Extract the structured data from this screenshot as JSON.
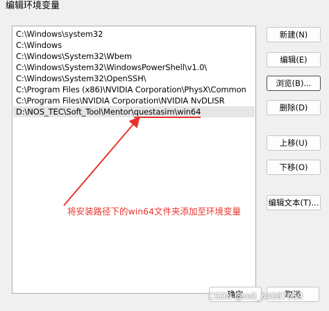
{
  "window": {
    "title": "编辑环境变量"
  },
  "list": {
    "items": [
      {
        "text": "C:\\Windows\\system32"
      },
      {
        "text": "C:\\Windows"
      },
      {
        "text": "C:\\Windows\\System32\\Wbem"
      },
      {
        "text": "C:\\Windows\\System32\\WindowsPowerShell\\v1.0\\"
      },
      {
        "text": "C:\\Windows\\System32\\OpenSSH\\"
      },
      {
        "text": "C:\\Program Files (x86)\\NVIDIA Corporation\\PhysX\\Common"
      },
      {
        "text": "C:\\Program Files\\NVIDIA Corporation\\NVIDIA NvDLISR"
      }
    ],
    "selected": {
      "prefix": "D:\\NOS_TEC\\Soft_Tool\\Mentor\\",
      "highlight": "questasim\\win64"
    }
  },
  "buttons": {
    "new": "新建(N)",
    "edit": "编辑(E)",
    "browse": "浏览(B)...",
    "delete": "删除(D)",
    "move_up": "上移(U)",
    "move_down": "下移(O)",
    "edit_text": "编辑文本(T)...",
    "ok": "确定",
    "cancel": "取消"
  },
  "annotation": {
    "text": "将安装路径下的win64文件夹添加至环境变量",
    "color": "#e8322b"
  },
  "watermark": {
    "text": "CSDN @m0_64087059"
  }
}
